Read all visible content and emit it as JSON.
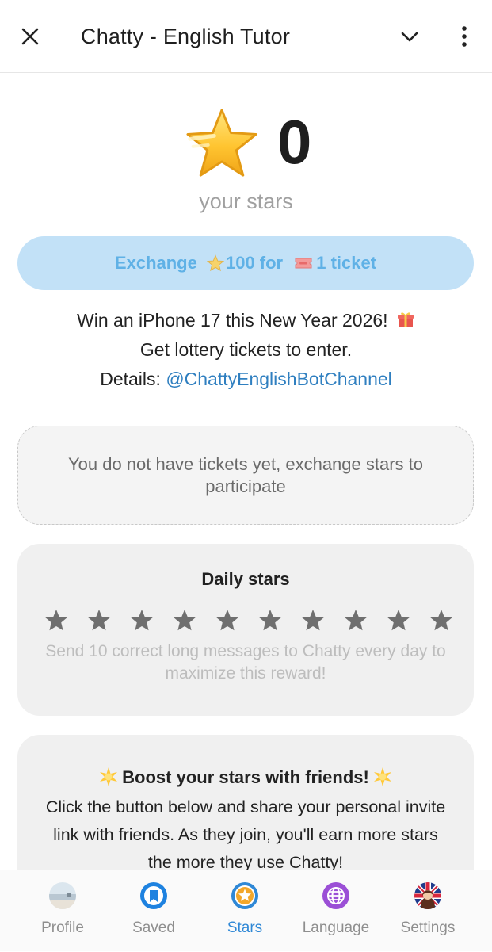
{
  "header": {
    "title": "Chatty - English Tutor",
    "close_icon": "close-icon",
    "chevron_icon": "chevron-down-icon",
    "more_icon": "more-vertical-icon"
  },
  "stars": {
    "count": "0",
    "label": "your stars"
  },
  "exchange": {
    "prefix": "Exchange ",
    "stars_amount": "100 for ",
    "tickets_amount": "1 ticket"
  },
  "promo": {
    "line1": "Win an iPhone 17 this New Year 2026!",
    "line2": "Get lottery tickets to enter.",
    "line3_prefix": "Details: ",
    "line3_link": "@ChattyEnglishBotChannel"
  },
  "tickets_notice": "You do not have tickets yet, exchange stars to participate",
  "daily": {
    "title": "Daily stars",
    "stars_earned": 0,
    "stars_total": 10,
    "note": "Send 10 correct long messages to Chatty every day to maximize this reward!"
  },
  "boost": {
    "title": "Boost your stars with friends!",
    "text": "Click the button below and share your personal invite link with friends. As they join, you'll earn more stars the more they use Chatty!"
  },
  "tabs": [
    {
      "label": "Profile",
      "icon": "profile-avatar-icon"
    },
    {
      "label": "Saved",
      "icon": "bookmark-icon"
    },
    {
      "label": "Stars",
      "icon": "star-icon",
      "active": true
    },
    {
      "label": "Language",
      "icon": "globe-icon"
    },
    {
      "label": "Settings",
      "icon": "settings-avatar-icon"
    }
  ],
  "colors": {
    "accent": "#2f88d6",
    "exchange_bg": "#c2e1f7",
    "exchange_text": "#5fb1e6",
    "link": "#2f7fc0",
    "card_bg": "#f0f0f0"
  }
}
